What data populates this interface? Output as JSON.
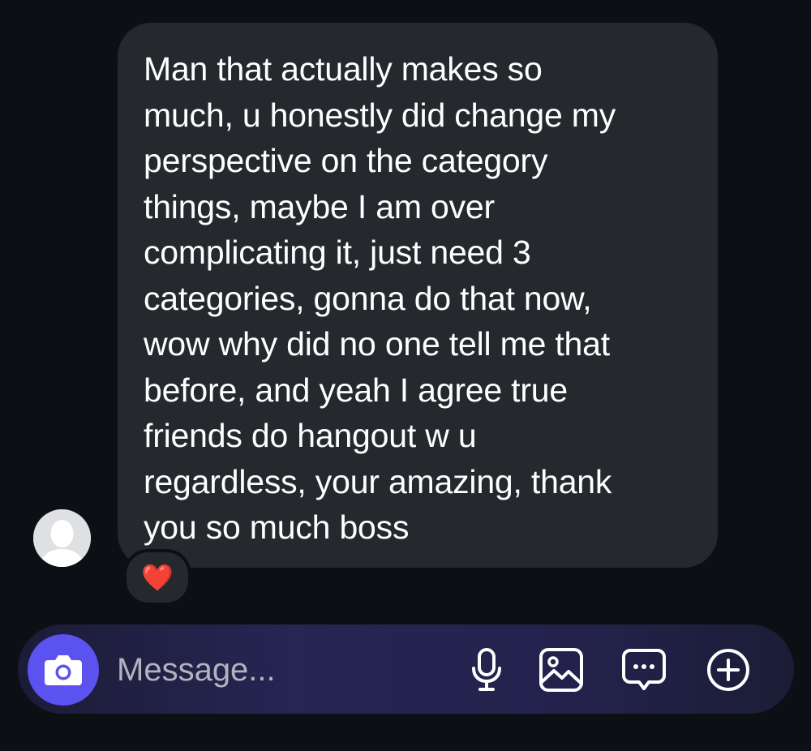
{
  "conversation": {
    "message_text": "Man that actually makes so\nmuch, u honestly did change my\nperspective on the category\nthings, maybe I am over\ncomplicating it, just need 3\ncategories, gonna do that now,\nwow why did no one tell me that\nbefore, and yeah I agree true\nfriends do hangout w u\nregardless, your amazing, thank\nyou so much boss",
    "reaction_emoji": "❤️"
  },
  "composer": {
    "placeholder": "Message..."
  },
  "icons": {
    "avatar": "default-avatar-icon",
    "camera": "camera-icon",
    "microphone": "microphone-icon",
    "gallery": "gallery-icon",
    "sticker": "chat-bubble-icon",
    "add": "plus-circle-icon"
  },
  "colors": {
    "background": "#0c1014",
    "bubble": "#25282d",
    "camera_button": "#5b52f0",
    "composer_start": "#1c1c38",
    "composer_mid": "#262553",
    "text": "#ffffff",
    "placeholder": "#b3b3bf"
  }
}
